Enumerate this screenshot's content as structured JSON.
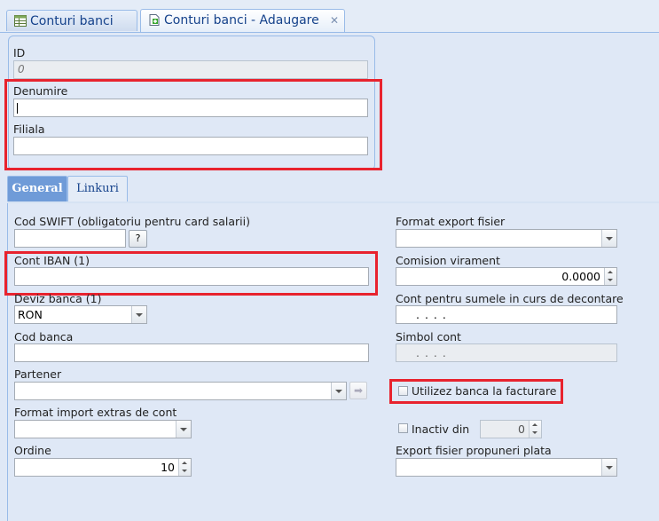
{
  "tabs": [
    {
      "label": "Conturi banci",
      "icon": "table-icon"
    },
    {
      "label": "Conturi banci - Adaugare",
      "icon": "document-add-icon",
      "close": "✕"
    }
  ],
  "header": {
    "id_label": "ID",
    "id_placeholder": "0",
    "denumire_label": "Denumire",
    "denumire_value": "",
    "filiala_label": "Filiala",
    "filiala_value": ""
  },
  "subtabs": [
    "General",
    "Linkuri"
  ],
  "left": {
    "swift_label": "Cod SWIFT (obligatoriu pentru card salarii)",
    "swift_value": "",
    "swift_help": "?",
    "iban_label": "Cont IBAN (1)",
    "iban_value": "",
    "deviz_label": "Deviz banca (1)",
    "deviz_value": "RON",
    "cod_banca_label": "Cod banca",
    "cod_banca_value": "",
    "partener_label": "Partener",
    "partener_value": "",
    "format_import_label": "Format import extras de cont",
    "format_import_value": "",
    "ordine_label": "Ordine",
    "ordine_value": "10"
  },
  "right": {
    "format_export_label": "Format export fisier",
    "format_export_value": "",
    "comision_label": "Comision virament",
    "comision_value": "0.0000",
    "cont_decontare_label": "Cont pentru sumele in curs de decontare",
    "cont_decontare_value": ". . . .",
    "simbol_label": "Simbol cont",
    "simbol_value": ". . . .",
    "utilizez_label": "Utilizez banca la facturare",
    "utilizez_checked": false,
    "inactiv_label": "Inactiv din",
    "inactiv_checked": false,
    "inactiv_value": "0",
    "export_propuneri_label": "Export fisier propuneri plata",
    "export_propuneri_value": ""
  },
  "colors": {
    "highlight": "#e8232e",
    "tab_active": "#6f9bd8",
    "background": "#dfe8f6"
  }
}
